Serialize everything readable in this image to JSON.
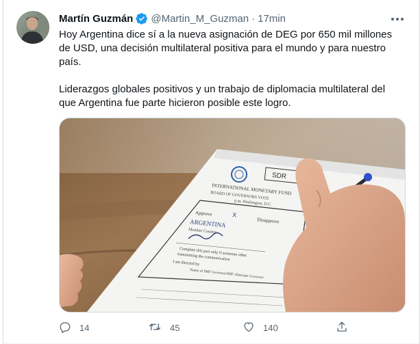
{
  "tweet": {
    "author_name": "Martín Guzmán",
    "handle": "@Martin_M_Guzman",
    "separator": "·",
    "time": "17min",
    "paragraphs": [
      "Hoy Argentina dice sí a la nueva asignación de DEG por 650 mil millones de USD, una decisión multilateral positiva para el mundo y para nuestro país.",
      "Liderazgos globales positivos y un trabajo de diplomacia multilateral del que Argentina fue parte hicieron posible este logro."
    ],
    "media": {
      "doc_header": "INTERNATIONAL MONETARY FUND",
      "doc_subheader": "BOARD OF GOVERNORS VOTE",
      "doc_location": "p.m. Washington, D.C.",
      "doc_approve": "Approve",
      "doc_disapprove": "Disapprove",
      "doc_country": "ARGENTINA",
      "doc_member_country": "Member Country",
      "doc_complete": "Complete this part only if someone other",
      "doc_transmitting": "transmitting the communication",
      "doc_directed": "I am directed by",
      "doc_name": "Name of IMF Governor/IMF Alternate Governor",
      "doc_sdr": "SDR"
    }
  },
  "actions": {
    "reply_count": "14",
    "retweet_count": "45",
    "like_count": "140"
  },
  "colors": {
    "verified": "#1d9bf0",
    "secondary_text": "#536471",
    "primary_text": "#0f1419"
  }
}
